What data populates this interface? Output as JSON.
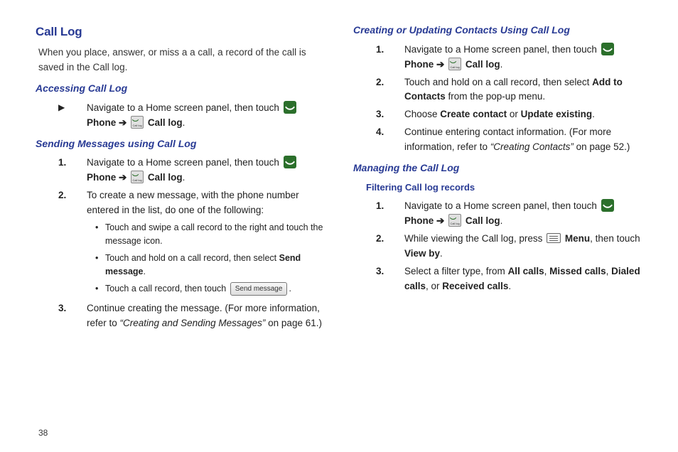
{
  "page_number": "38",
  "left": {
    "h1": "Call Log",
    "intro": "When you place, answer, or miss a a call, a record of the call is saved in the Call log.",
    "accessing_h": "Accessing Call Log",
    "accessing_item": {
      "pre": "Navigate to a Home screen panel, then touch ",
      "phone": "Phone",
      "arrow": "➔",
      "calllog": "Call log",
      "end": "."
    },
    "sending_h": "Sending Messages using Call Log",
    "sending": {
      "1_pre": "Navigate to a Home screen panel, then touch ",
      "1_phone": "Phone",
      "1_arrow": "➔",
      "1_calllog": "Call log",
      "1_end": ".",
      "2": "To create a new message, with the phone number entered in the list, do one of the following:",
      "b1": "Touch and swipe a call record to the right and touch the message icon.",
      "b2_pre": "Touch and hold on a call record, then select ",
      "b2_bold": "Send message",
      "b2_end": ".",
      "b3_pre": "Touch a call record, then touch ",
      "b3_btn": "Send message",
      "b3_end": ".",
      "3_pre": "Continue creating the message. (For more information, refer to ",
      "3_ref": "“Creating and Sending Messages”",
      "3_end": " on page 61.)"
    }
  },
  "right": {
    "creating_h": "Creating or Updating Contacts Using Call Log",
    "creating": {
      "1_pre": "Navigate to a Home screen panel, then touch ",
      "1_phone": "Phone",
      "1_arrow": "➔",
      "1_calllog": "Call log",
      "1_end": ".",
      "2_pre": "Touch and hold on a call record, then select ",
      "2_b1": "Add to Contacts",
      "2_end": " from the pop-up menu.",
      "3_pre": "Choose ",
      "3_b1": "Create contact",
      "3_mid": " or ",
      "3_b2": "Update existing",
      "3_end": ".",
      "4_pre": "Continue entering contact information. (For more information, refer to ",
      "4_ref": "“Creating Contacts”",
      "4_end": " on page 52.)"
    },
    "managing_h": "Managing the Call Log",
    "filtering_h": "Filtering Call log records",
    "filtering": {
      "1_pre": "Navigate to a Home screen panel, then touch ",
      "1_phone": "Phone",
      "1_arrow": "➔",
      "1_calllog": "Call log",
      "1_end": ".",
      "2_pre": "While viewing the Call log, press ",
      "2_menu": "Menu",
      "2_mid": ", then touch ",
      "2_b": "View by",
      "2_end": ".",
      "3_pre": "Select a filter type, from ",
      "3_b1": "All calls",
      "3_c1": ", ",
      "3_b2": "Missed calls",
      "3_c2": ", ",
      "3_b3": "Dialed calls",
      "3_c3": ", or ",
      "3_b4": "Received calls",
      "3_end": "."
    }
  }
}
